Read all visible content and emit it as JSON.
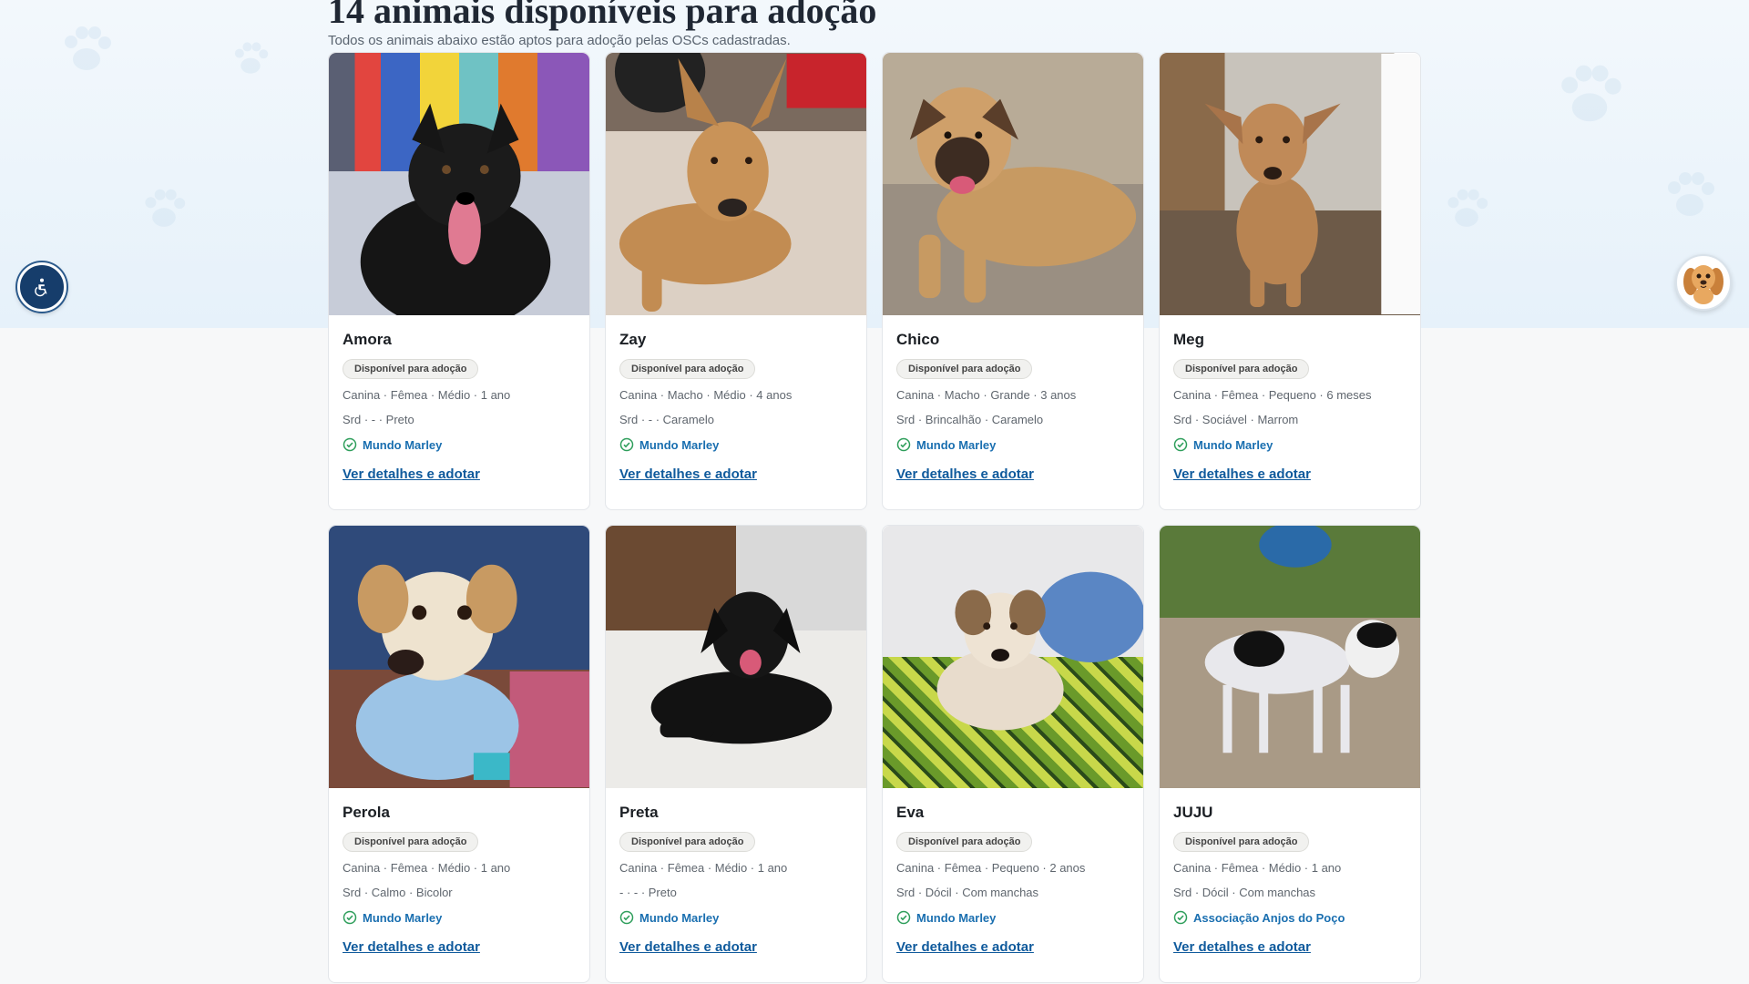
{
  "header": {
    "title": "14 animais disponíveis para adoção",
    "subtitle": "Todos os animais abaixo estão aptos para adoção pelas OSCs cadastradas."
  },
  "labels": {
    "badge": "Disponível para adoção",
    "details_link": "Ver detalhes e adotar"
  },
  "icons": {
    "accessibility": "accessibility-icon",
    "mascot": "dog-mascot-icon",
    "verified": "verified-check-icon"
  },
  "colors": {
    "accent": "#0f5a9c",
    "org": "#1a6fb0",
    "check": "#2e9e5b",
    "a11y": "#163d6b"
  },
  "pets": [
    {
      "name": "Amora",
      "line1": "Canina · Fêmea · Médio · 1 ano",
      "line2": "Srd · - · Preto",
      "org": "Mundo Marley"
    },
    {
      "name": "Zay",
      "line1": "Canina · Macho · Médio · 4 anos",
      "line2": "Srd · - · Caramelo",
      "org": "Mundo Marley"
    },
    {
      "name": "Chico",
      "line1": "Canina · Macho · Grande · 3 anos",
      "line2": "Srd · Brincalhão · Caramelo",
      "org": "Mundo Marley"
    },
    {
      "name": "Meg",
      "line1": "Canina · Fêmea · Pequeno · 6 meses",
      "line2": "Srd · Sociável · Marrom",
      "org": "Mundo Marley"
    },
    {
      "name": "Perola",
      "line1": "Canina · Fêmea · Médio · 1 ano",
      "line2": "Srd · Calmo · Bicolor",
      "org": "Mundo Marley"
    },
    {
      "name": "Preta",
      "line1": "Canina · Fêmea · Médio · 1 ano",
      "line2": "- · - · Preto",
      "org": "Mundo Marley"
    },
    {
      "name": "Eva",
      "line1": "Canina · Fêmea · Pequeno · 2 anos",
      "line2": "Srd · Dócil · Com manchas",
      "org": "Mundo Marley"
    },
    {
      "name": "JUJU",
      "line1": "Canina · Fêmea · Médio · 1 ano",
      "line2": "Srd · Dócil · Com manchas",
      "org": "Associação Anjos do Poço"
    }
  ]
}
